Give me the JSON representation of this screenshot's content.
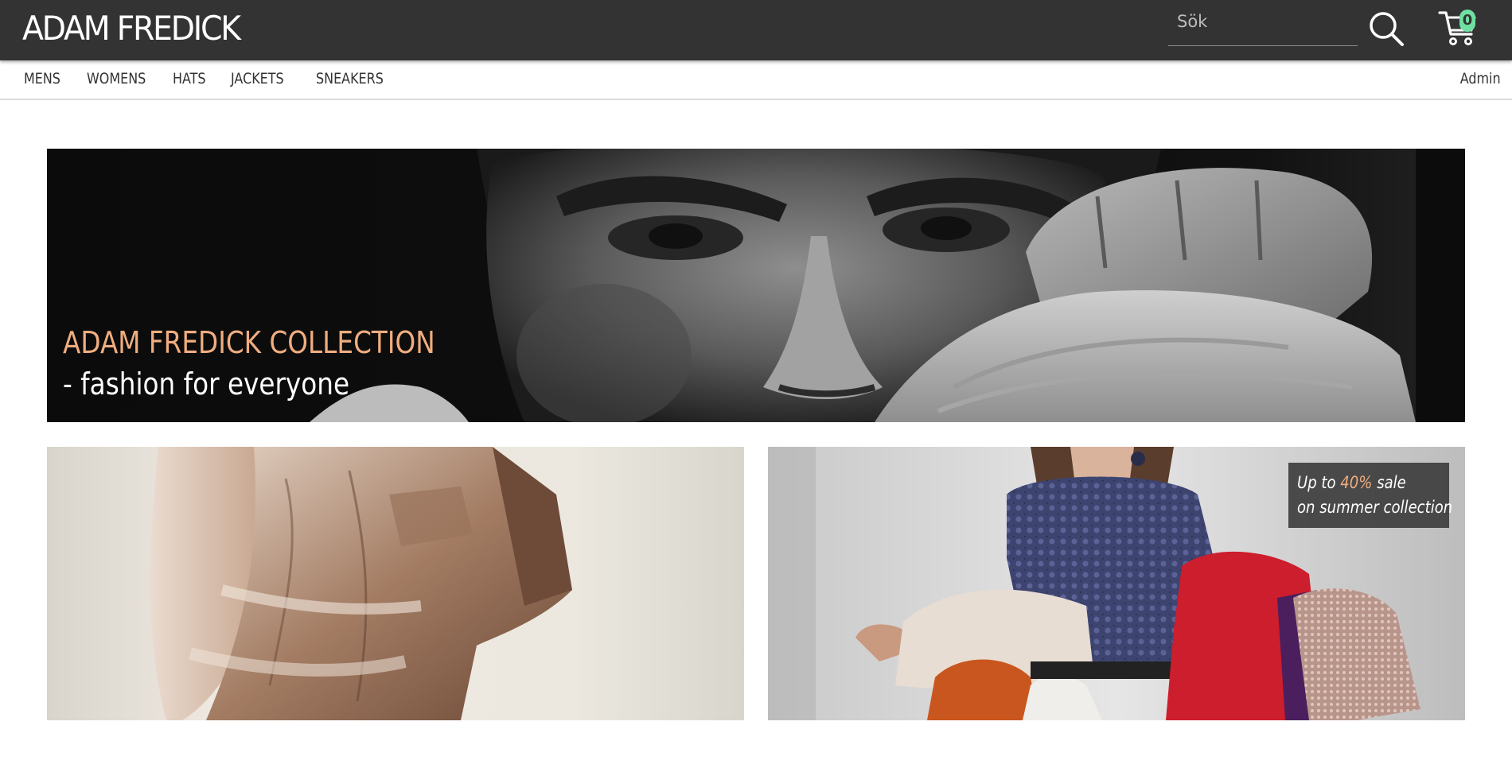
{
  "header": {
    "brand": "ADAM FREDICK",
    "search": {
      "placeholder": "Sök",
      "value": ""
    },
    "cart_count": "0",
    "cart_badge_color": "#6fe0a2",
    "background": "#333333"
  },
  "nav": {
    "items": [
      "MENS",
      "WOMENS",
      "HATS",
      "JACKETS",
      "SNEAKERS"
    ],
    "admin": "Admin"
  },
  "hero": {
    "title": "ADAM FREDICK COLLECTION",
    "subtitle": "- fashion for everyone",
    "title_color": "#f0ad7f"
  },
  "promo": {
    "left_image": "shirt-photo",
    "right_image": "summer-collection-photo",
    "sale": {
      "prefix": "Up to ",
      "percent": "40%",
      "suffix": " sale",
      "line2": "on summer collection"
    }
  },
  "icons": {
    "search": "search-icon",
    "cart": "cart-icon"
  }
}
